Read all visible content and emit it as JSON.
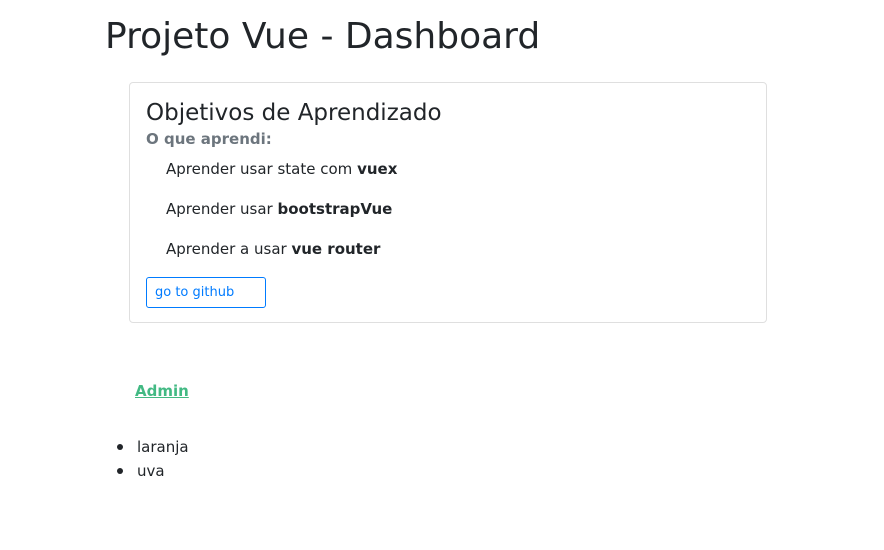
{
  "header": {
    "title": "Projeto Vue - Dashboard"
  },
  "card": {
    "title": "Objetivos de Aprendizado",
    "subtitle": "O que aprendi:",
    "items": [
      {
        "text": "Aprender usar state com ",
        "bold": "vuex"
      },
      {
        "text": "Aprender usar ",
        "bold": "bootstrapVue"
      },
      {
        "text": "Aprender a usar ",
        "bold": "vue router"
      }
    ],
    "button_label": "go to github"
  },
  "nav": {
    "admin_label": "Admin"
  },
  "fruits": [
    "laranja",
    "uva"
  ],
  "colors": {
    "link_green": "#42b983",
    "primary_blue": "#007bff",
    "muted_gray": "#6c757d"
  }
}
